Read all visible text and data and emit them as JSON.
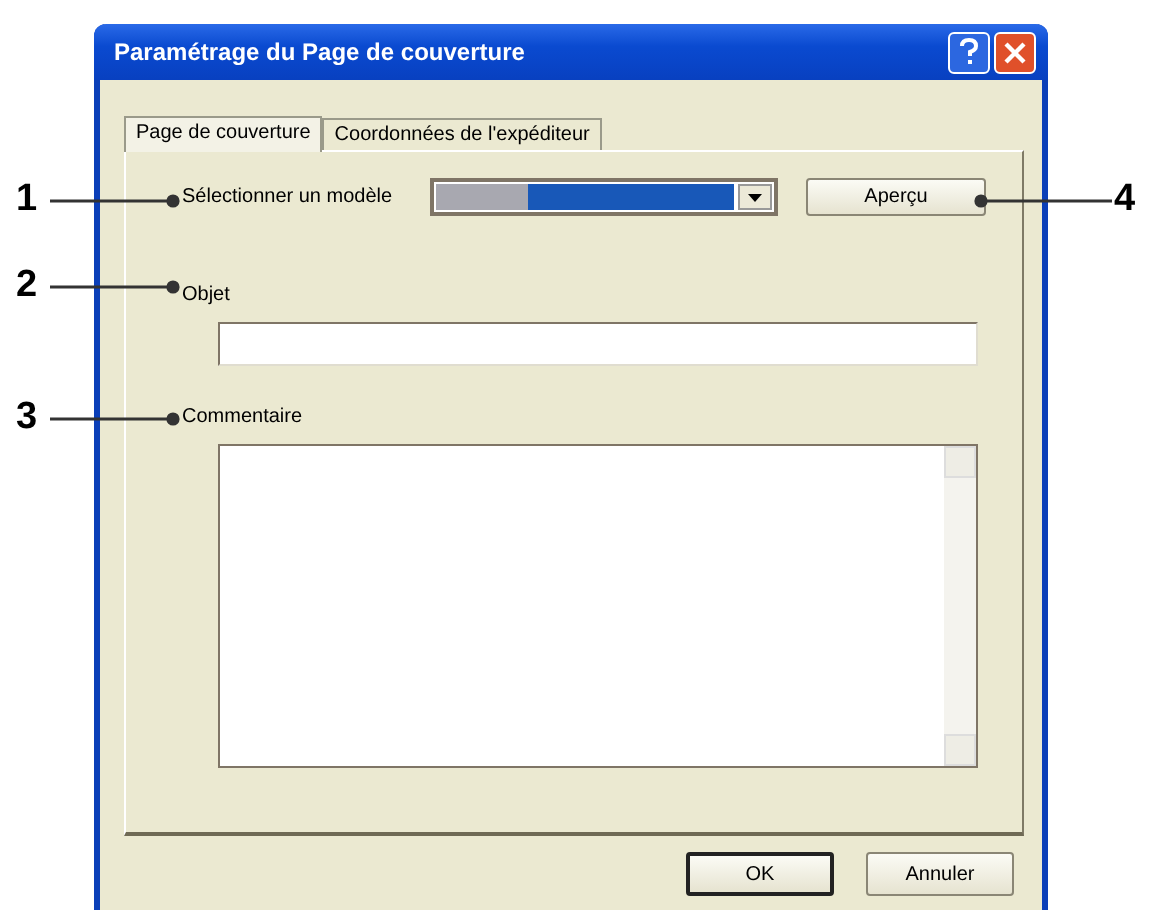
{
  "window": {
    "title": "Paramétrage du Page de couverture"
  },
  "tabs": [
    {
      "label": "Page de couverture",
      "selected": true
    },
    {
      "label": "Coordonnées de l'expéditeur",
      "selected": false
    }
  ],
  "template": {
    "label": "Sélectionner un modèle"
  },
  "preview_button": "Aperçu",
  "subject": {
    "label": "Objet"
  },
  "comment": {
    "label": "Commentaire"
  },
  "buttons": [
    "OK",
    "Annuler"
  ],
  "callouts": [
    {
      "number": "1",
      "kind": "left"
    },
    {
      "number": "2",
      "kind": "left"
    },
    {
      "number": "3",
      "kind": "left"
    },
    {
      "number": "4",
      "kind": "right"
    }
  ]
}
